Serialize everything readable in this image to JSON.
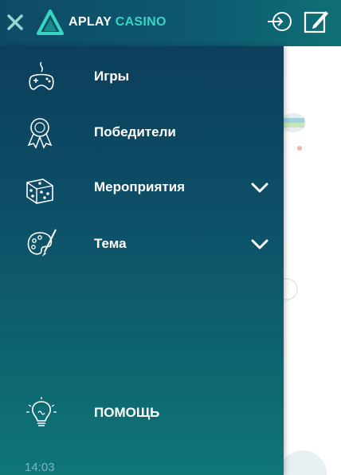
{
  "header": {
    "logo_text_primary": "APLAY",
    "logo_text_secondary": "CASINO",
    "accent_color": "#36d6c2"
  },
  "menu": {
    "items": [
      {
        "label": "Игры",
        "icon": "gamepad-icon",
        "expandable": false
      },
      {
        "label": "Победители",
        "icon": "medal-icon",
        "expandable": false
      },
      {
        "label": "Мероприятия",
        "icon": "dice-icon",
        "expandable": true
      },
      {
        "label": "Тема",
        "icon": "palette-icon",
        "expandable": true
      }
    ],
    "help": {
      "label": "ПОМОЩЬ",
      "icon": "lightbulb-icon"
    }
  },
  "status": {
    "time": "14:03"
  }
}
